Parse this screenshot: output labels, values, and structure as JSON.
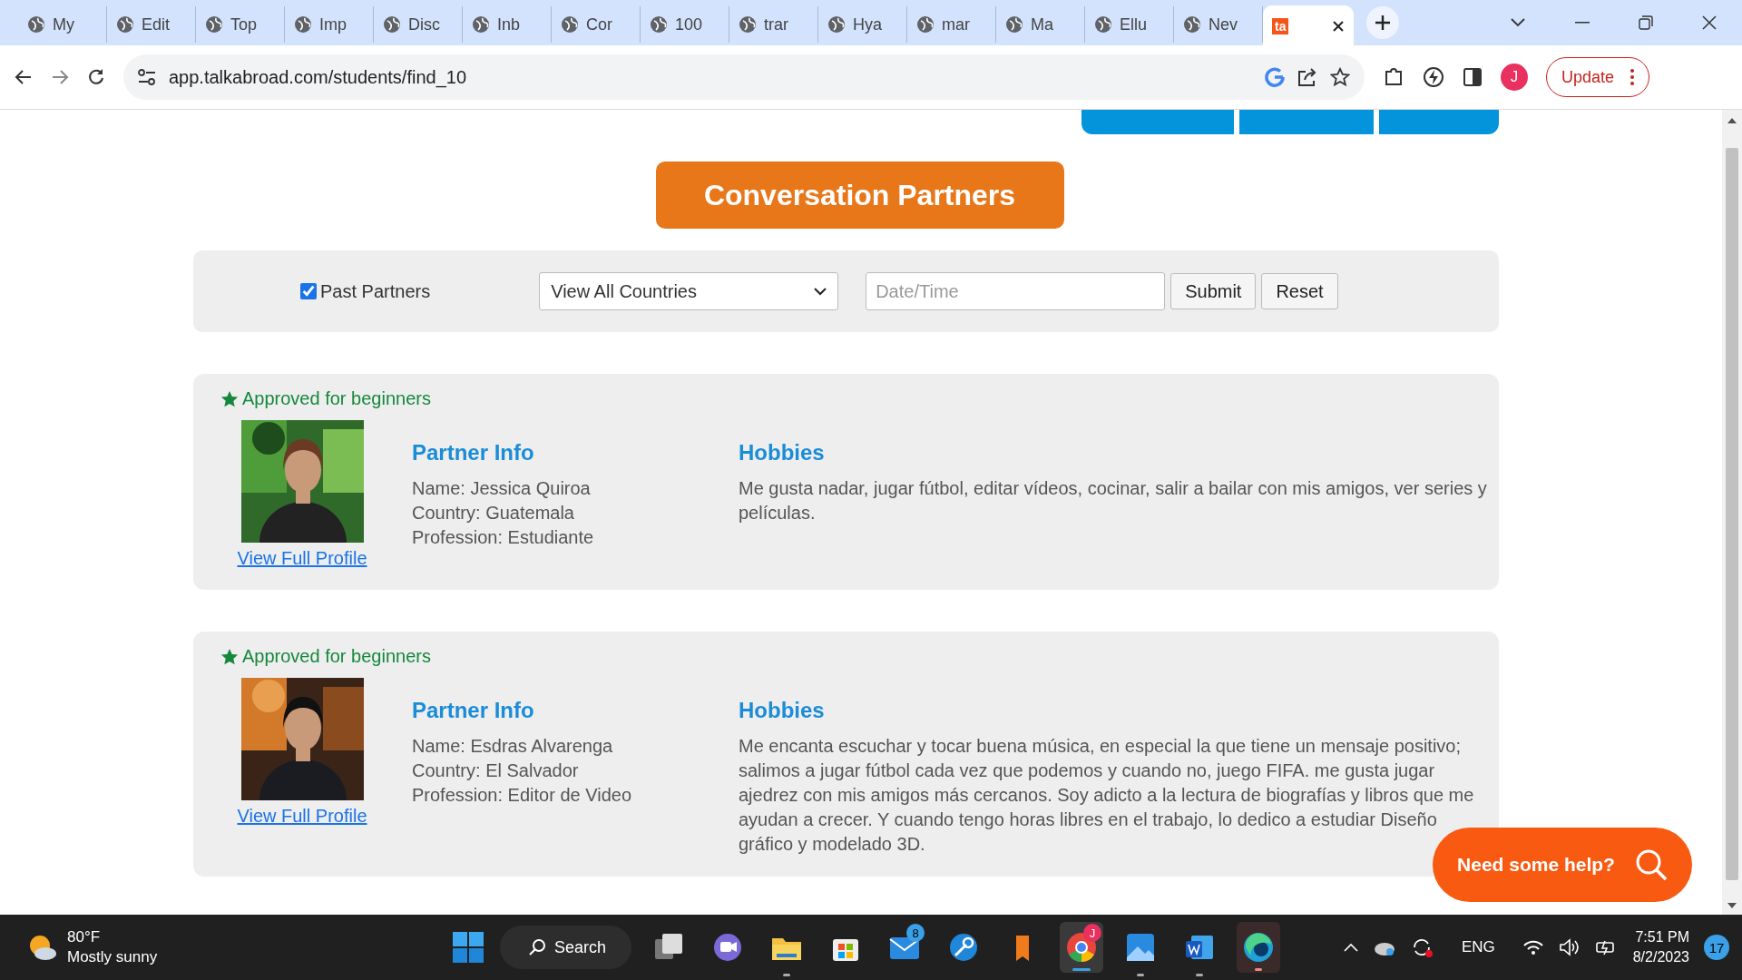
{
  "browser": {
    "tabs": [
      {
        "title": "My",
        "selected": false
      },
      {
        "title": "Edit",
        "selected": false
      },
      {
        "title": "Top",
        "selected": false
      },
      {
        "title": "Imp",
        "selected": false
      },
      {
        "title": "Disc",
        "selected": false
      },
      {
        "title": "Inb",
        "selected": false
      },
      {
        "title": "Cor",
        "selected": false
      },
      {
        "title": "100",
        "selected": false
      },
      {
        "title": "trar",
        "selected": false
      },
      {
        "title": "Hya",
        "selected": false
      },
      {
        "title": "mar",
        "selected": false
      },
      {
        "title": "Ma",
        "selected": false
      },
      {
        "title": "Ellu",
        "selected": false
      },
      {
        "title": "Nev",
        "selected": false
      },
      {
        "icon_text": "ta",
        "selected": true
      }
    ],
    "url": "app.talkabroad.com/students/find_10",
    "profile_initial": "J",
    "update_button": "Update"
  },
  "page": {
    "title": "Conversation Partners",
    "filters": {
      "past_partners": {
        "label": "Past Partners",
        "checked": true
      },
      "country": "View All Countries",
      "date_placeholder": "Date/Time",
      "buttons": [
        "Submit",
        "Reset"
      ]
    },
    "partners": [
      {
        "badge": "Approved for beginners",
        "info_heading": "Partner Info",
        "name": "Name: Jessica Quiroa",
        "country": "Country: Guatemala",
        "profession": "Profession: Estudiante",
        "link": "View Full Profile",
        "hobbies_heading": "Hobbies",
        "hobbies": "Me gusta nadar, jugar fútbol, editar vídeos, cocinar, salir a bailar con mis amigos, ver series y películas."
      },
      {
        "badge": "Approved for beginners",
        "info_heading": "Partner Info",
        "name": "Name: Esdras Alvarenga",
        "country": "Country: El Salvador",
        "profession": "Profession: Editor de Video",
        "link": "View Full Profile",
        "hobbies_heading": "Hobbies",
        "hobbies": "Me encanta escuchar y tocar buena música, en especial la que tiene un mensaje positivo; salimos a jugar fútbol cada vez que podemos y cuando no, juego FIFA. me gusta jugar ajedrez con mis amigos más cercanos. Soy adicto a la lectura de biografías y libros que me ayudan a crecer. Y cuando tengo horas libres en el trabajo, lo dedico a estudiar Diseño gráfico y modelado 3D."
      }
    ],
    "help_button": "Need some help?"
  },
  "taskbar": {
    "weather": {
      "temp": "80°F",
      "condition": "Mostly sunny"
    },
    "search": "Search",
    "mail_badge": "8",
    "chrome_badge": "J",
    "language": "ENG",
    "time": "7:51 PM",
    "date": "8/2/2023",
    "notifications": "17"
  }
}
